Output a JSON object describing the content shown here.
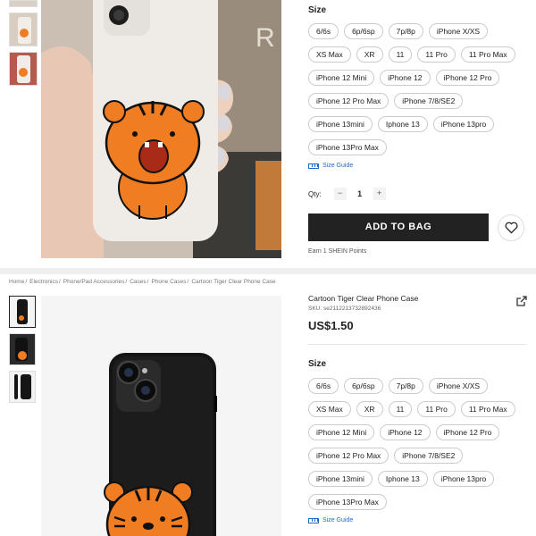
{
  "top": {
    "size_title": "Size",
    "sizes": [
      "6/6s",
      "6p/6sp",
      "7p/8p",
      "iPhone X/XS",
      "XS Max",
      "XR",
      "11",
      "11 Pro",
      "11 Pro Max",
      "iPhone 12 Mini",
      "iPhone 12",
      "iPhone 12 Pro",
      "iPhone 12 Pro Max",
      "iPhone 7/8/SE2",
      "iPhone 13mini",
      "Iphone 13",
      "iPhone 13pro",
      "iPhone 13Pro Max"
    ],
    "size_guide": "Size Guide",
    "qty_label": "Qty:",
    "qty_minus": "−",
    "qty_value": "1",
    "qty_plus": "+",
    "add_to_bag": "ADD TO BAG",
    "earn_points": "Earn 1 SHEIN Points"
  },
  "bottom": {
    "breadcrumb": [
      "Home",
      "Electronics",
      "Phone/Pad Accessories",
      "Cases",
      "Phone Cases",
      "Cartoon Tiger Clear Phone Case"
    ],
    "breadcrumb_sep": "/",
    "title": "Cartoon Tiger Clear Phone Case",
    "sku": "SKU: se2112213732892436",
    "price": "US$1.50",
    "size_title": "Size",
    "sizes": [
      "6/6s",
      "6p/6sp",
      "7p/8p",
      "iPhone X/XS",
      "XS Max",
      "XR",
      "11",
      "11 Pro",
      "11 Pro Max",
      "iPhone 12 Mini",
      "iPhone 12",
      "iPhone 12 Pro",
      "iPhone 12 Pro Max",
      "iPhone 7/8/SE2",
      "iPhone 13mini",
      "Iphone 13",
      "iPhone 13pro",
      "iPhone 13Pro Max"
    ],
    "size_guide": "Size Guide"
  },
  "colors": {
    "accent_link": "#1d6bc9",
    "button_dark": "#222222",
    "tiger_orange": "#f07d22",
    "case_white": "#efece8",
    "case_black": "#151515"
  },
  "icons": [
    "ruler-icon",
    "heart-icon",
    "share-icon",
    "minus-icon",
    "plus-icon"
  ]
}
